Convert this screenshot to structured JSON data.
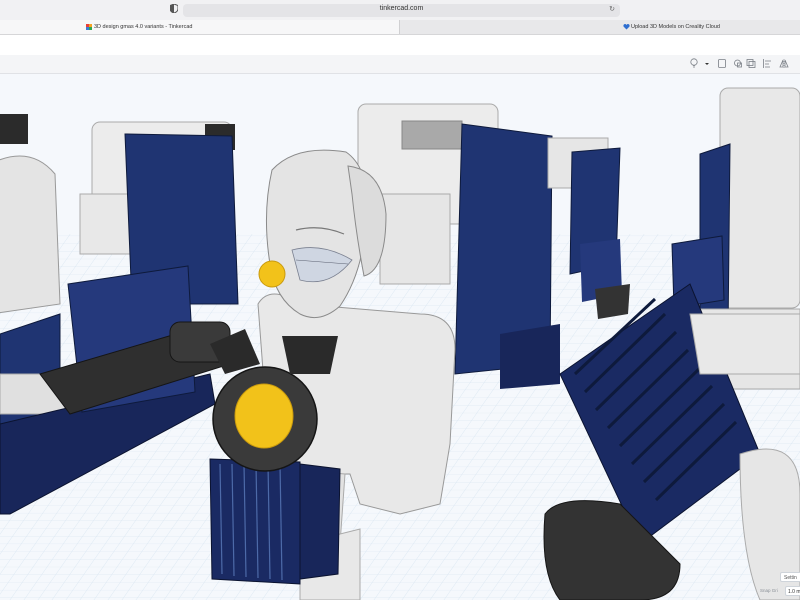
{
  "browser": {
    "address": "tinkercad.com",
    "tabs": [
      {
        "label": "3D design gmas 4.0 variants - Tinkercad",
        "active": true
      },
      {
        "label": "Upload 3D Models on Creality Cloud",
        "active": false
      }
    ]
  },
  "toolbar": {
    "icons": [
      "lightbulb-icon",
      "chevron-down-icon",
      "note-icon",
      "group-icon",
      "duplicate-icon",
      "align-icon",
      "mirror-icon"
    ]
  },
  "scene_controls": {
    "settings_label": "Settin",
    "snap_label": "Snap Gri",
    "snap_value": "1.0 m"
  },
  "colors": {
    "navy": "#1f3472",
    "body_gray": "#e6e6e6",
    "gun_dark": "#333333",
    "lens_yellow": "#f2c21a",
    "grid": "#cfe0ee"
  }
}
